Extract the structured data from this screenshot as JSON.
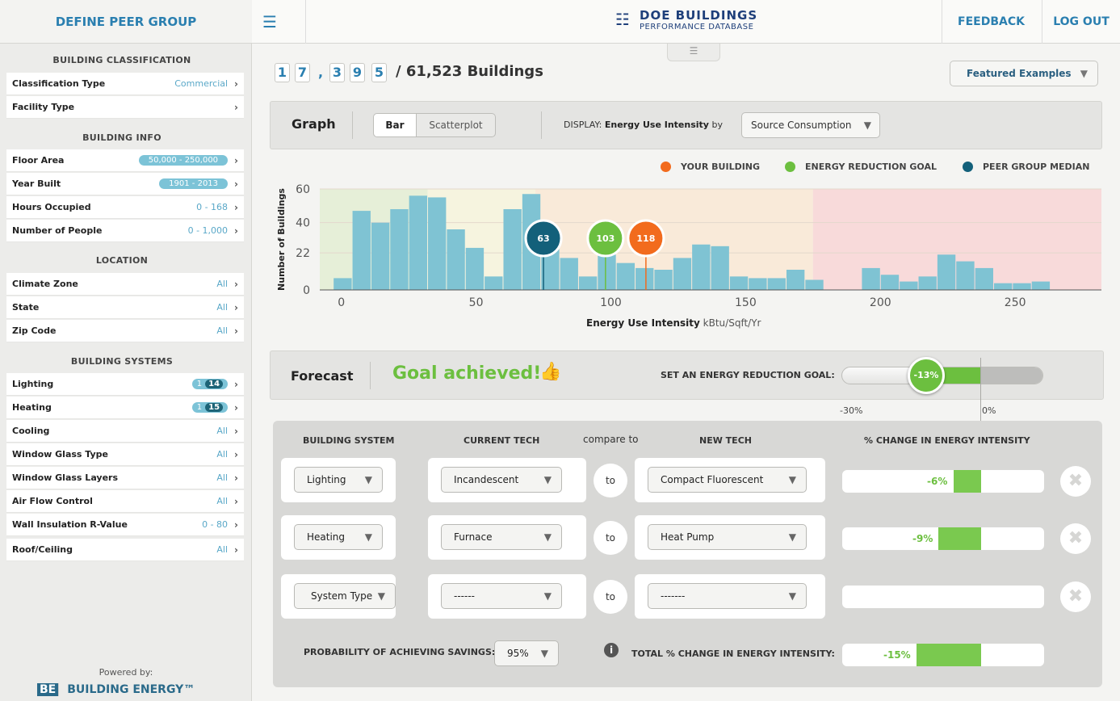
{
  "sidebar": {
    "title": "DEFINE PEER GROUP",
    "sections": {
      "classification": "BUILDING CLASSIFICATION",
      "info": "BUILDING INFO",
      "location": "LOCATION",
      "systems": "BUILDING SYSTEMS"
    },
    "classification_type": {
      "label": "Classification Type",
      "value": "Commercial"
    },
    "facility_type": {
      "label": "Facility Type"
    },
    "floor_area": {
      "label": "Floor Area",
      "value": "50,000 - 250,000"
    },
    "year_built": {
      "label": "Year Built",
      "value": "1901 - 2013"
    },
    "hours_occupied": {
      "label": "Hours Occupied",
      "value": "0 - 168"
    },
    "num_people": {
      "label": "Number of People",
      "value": "0 - 1,000"
    },
    "climate_zone": {
      "label": "Climate Zone",
      "value": "All"
    },
    "state": {
      "label": "State",
      "value": "All"
    },
    "zip_code": {
      "label": "Zip Code",
      "value": "All"
    },
    "lighting": {
      "label": "Lighting",
      "pill_a": "1",
      "pill_b": "14"
    },
    "heating": {
      "label": "Heating",
      "pill_a": "1",
      "pill_b": "15"
    },
    "cooling": {
      "label": "Cooling",
      "value": "All"
    },
    "window_glass_type": {
      "label": "Window Glass Type",
      "value": "All"
    },
    "window_glass_layers": {
      "label": "Window Glass Layers",
      "value": "All"
    },
    "air_flow": {
      "label": "Air Flow Control",
      "value": "All"
    },
    "wall_insulation": {
      "label": "Wall Insulation R-Value",
      "value": "0 - 80"
    },
    "roof": {
      "label": "Roof/Ceiling",
      "value": "All"
    },
    "powered_by": "Powered by:",
    "brand": "BUILDING ENERGY™",
    "brand_mark": "BE"
  },
  "header": {
    "logo_line1": "DOE BUILDINGS",
    "logo_line2": "PERFORMANCE DATABASE",
    "feedback": "FEEDBACK",
    "logout": "LOG OUT",
    "menu_icon": "hamburger-icon"
  },
  "counter": {
    "digits": [
      "1",
      "7",
      "3",
      "9",
      "5"
    ],
    "comma": ",",
    "suffix": "/ 61,523 Buildings"
  },
  "featured": {
    "label": "Featured Examples"
  },
  "graph": {
    "title": "Graph",
    "tab_bar": "Bar",
    "tab_scatter": "Scatterplot",
    "display_prefix": "DISPLAY:",
    "display_metric": "Energy Use Intensity",
    "display_by": "by",
    "display_select": "Source Consumption"
  },
  "legend": {
    "your_building": "YOUR BUILDING",
    "goal": "ENERGY REDUCTION GOAL",
    "median": "PEER GROUP MEDIAN"
  },
  "colors": {
    "bar": "#7fc3d3",
    "your_building": "#f26b1d",
    "goal": "#6cbf3f",
    "median": "#13607a",
    "accent": "#2a7fb0"
  },
  "chart_data": {
    "type": "bar",
    "xlabel": "Energy Use Intensity",
    "xlabel_unit": "kBtu/Sqft/Yr",
    "ylabel": "Number of Buildings",
    "xlim": [
      -5,
      285
    ],
    "ylim": [
      0,
      60
    ],
    "xticks": [
      0,
      50,
      100,
      150,
      200,
      250
    ],
    "yticks": [
      0,
      22,
      40,
      60
    ],
    "bin_width": 7,
    "bins": [
      {
        "x": 0,
        "y": 7
      },
      {
        "x": 7,
        "y": 47
      },
      {
        "x": 14,
        "y": 40
      },
      {
        "x": 21,
        "y": 48
      },
      {
        "x": 28,
        "y": 56
      },
      {
        "x": 35,
        "y": 55
      },
      {
        "x": 42,
        "y": 36
      },
      {
        "x": 49,
        "y": 25
      },
      {
        "x": 56,
        "y": 8
      },
      {
        "x": 63,
        "y": 48
      },
      {
        "x": 70,
        "y": 57
      },
      {
        "x": 77,
        "y": 32
      },
      {
        "x": 84,
        "y": 19
      },
      {
        "x": 91,
        "y": 8
      },
      {
        "x": 98,
        "y": 21
      },
      {
        "x": 105,
        "y": 16
      },
      {
        "x": 112,
        "y": 13
      },
      {
        "x": 119,
        "y": 12
      },
      {
        "x": 126,
        "y": 19
      },
      {
        "x": 133,
        "y": 27
      },
      {
        "x": 140,
        "y": 26
      },
      {
        "x": 147,
        "y": 8
      },
      {
        "x": 154,
        "y": 7
      },
      {
        "x": 161,
        "y": 7
      },
      {
        "x": 168,
        "y": 12
      },
      {
        "x": 175,
        "y": 6
      },
      {
        "x": 196,
        "y": 13
      },
      {
        "x": 203,
        "y": 9
      },
      {
        "x": 210,
        "y": 5
      },
      {
        "x": 217,
        "y": 8
      },
      {
        "x": 224,
        "y": 21
      },
      {
        "x": 231,
        "y": 17
      },
      {
        "x": 238,
        "y": 13
      },
      {
        "x": 245,
        "y": 4
      },
      {
        "x": 252,
        "y": 4
      },
      {
        "x": 259,
        "y": 5
      }
    ],
    "bands": [
      {
        "from": -5,
        "to": 35,
        "color": "#e6efd8"
      },
      {
        "from": 35,
        "to": 75,
        "color": "#f6f4df"
      },
      {
        "from": 75,
        "to": 178,
        "color": "#f9ead9"
      },
      {
        "from": 178,
        "to": 285,
        "color": "#f8dada"
      }
    ],
    "markers": [
      {
        "name": "median",
        "x": 78,
        "label": "63",
        "color": "#13607a"
      },
      {
        "name": "goal",
        "x": 101,
        "label": "103",
        "color": "#6cbf3f"
      },
      {
        "name": "your_building",
        "x": 116,
        "label": "118",
        "color": "#f26b1d"
      }
    ]
  },
  "forecast": {
    "title": "Forecast",
    "status": "Goal achieved!",
    "goal_label": "SET AN ENERGY REDUCTION GOAL:",
    "goal_value": "-13%",
    "goal_fraction": 0.43,
    "tick_min": "-30%",
    "tick_zero": "0%"
  },
  "systems": {
    "headers": {
      "system": "BUILDING SYSTEM",
      "current": "CURRENT TECH",
      "compare": "compare to",
      "new": "NEW TECH",
      "change": "% CHANGE IN ENERGY INTENSITY"
    },
    "rows": [
      {
        "system": "Lighting",
        "current": "Incandescent",
        "to": "to",
        "new": "Compact Fluorescent",
        "change": "-6%"
      },
      {
        "system": "Heating",
        "current": "Furnace",
        "to": "to",
        "new": "Heat Pump",
        "change": "-9%"
      },
      {
        "system": "System Type",
        "current": "------",
        "to": "to",
        "new": "-------",
        "change": ""
      }
    ],
    "probability_label": "PROBABILITY OF ACHIEVING SAVINGS:",
    "probability_value": "95%",
    "total_label": "TOTAL % CHANGE IN ENERGY INTENSITY:",
    "total_value": "-15%"
  }
}
